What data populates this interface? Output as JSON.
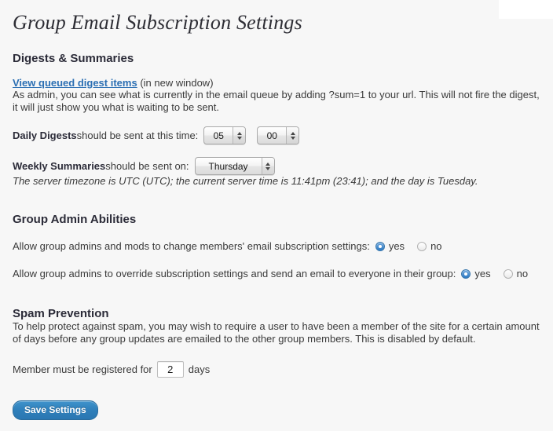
{
  "page": {
    "title": "Group Email Subscription Settings"
  },
  "digests": {
    "heading": "Digests & Summaries",
    "link_text": "View queued digest items",
    "link_note": " (in new window)",
    "description": "As admin, you can see what is currently in the email queue by adding ?sum=1 to your url. This will not fire the digest, it will just show you what is waiting to be sent.",
    "daily": {
      "label_bold": "Daily Digests",
      "label_rest": " should be sent at this time:",
      "hour_value": "05",
      "minute_value": "00"
    },
    "weekly": {
      "label_bold": "Weekly Summaries",
      "label_rest": " should be sent on:",
      "day_value": "Thursday"
    },
    "server_note": "The server timezone is UTC (UTC); the current server time is 11:41pm (23:41); and the day is Tuesday."
  },
  "admin": {
    "heading": "Group Admin Abilities",
    "row1": {
      "question": "Allow group admins and mods to change members' email subscription settings:",
      "yes_label": "yes",
      "no_label": "no",
      "selected": "yes"
    },
    "row2": {
      "question": "Allow group admins to override subscription settings and send an email to everyone in their group:",
      "yes_label": "yes",
      "no_label": "no",
      "selected": "yes"
    }
  },
  "spam": {
    "heading": "Spam Prevention",
    "description": "To help protect against spam, you may wish to require a user to have been a member of the site for a certain amount of days before any group updates are emailed to the other group members. This is disabled by default.",
    "days_label_before": "Member must be registered for",
    "days_value": "2",
    "days_label_after": "days"
  },
  "actions": {
    "save_label": "Save Settings"
  },
  "colors": {
    "accent_blue": "#2f7fba",
    "link_blue": "#2b6fb3",
    "page_bg": "#f7f7f7",
    "heading": "#2b2b38"
  }
}
